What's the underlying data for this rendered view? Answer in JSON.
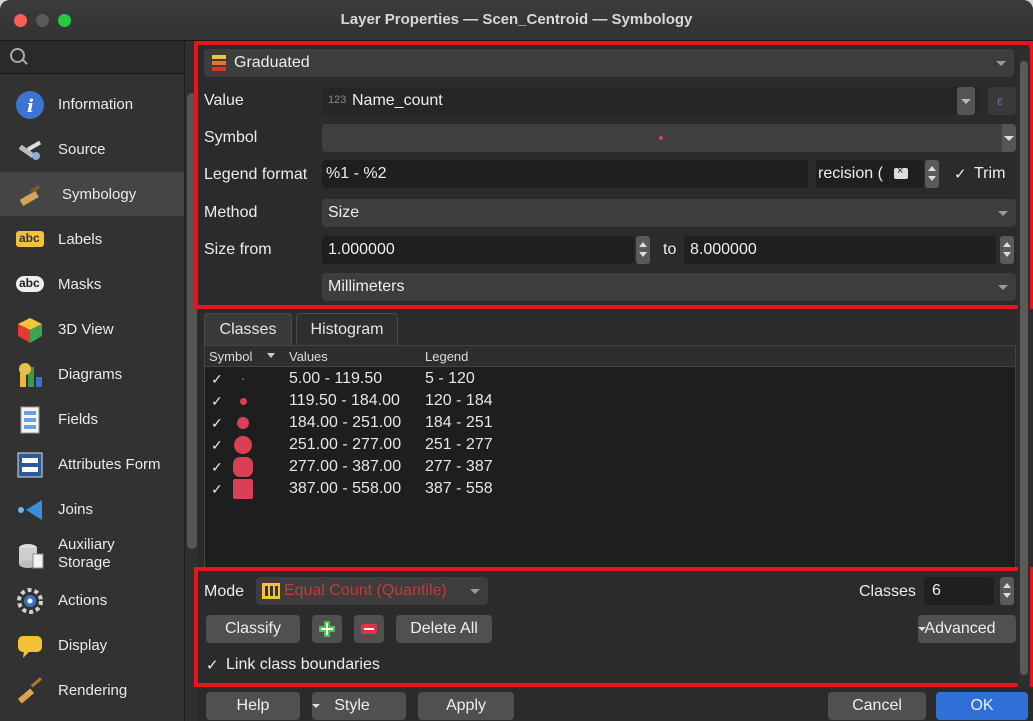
{
  "window": {
    "title": "Layer Properties — Scen_Centroid — Symbology"
  },
  "sidebar": {
    "items": [
      {
        "label": "Information",
        "icon": "info-icon"
      },
      {
        "label": "Source",
        "icon": "source-icon"
      },
      {
        "label": "Symbology",
        "icon": "brush-icon"
      },
      {
        "label": "Labels",
        "icon": "labels-icon"
      },
      {
        "label": "Masks",
        "icon": "masks-icon"
      },
      {
        "label": "3D View",
        "icon": "cube-icon"
      },
      {
        "label": "Diagrams",
        "icon": "diagrams-icon"
      },
      {
        "label": "Fields",
        "icon": "fields-icon"
      },
      {
        "label": "Attributes Form",
        "icon": "form-icon"
      },
      {
        "label": "Joins",
        "icon": "joins-icon"
      },
      {
        "label": "Auxiliary Storage",
        "icon": "storage-icon"
      },
      {
        "label": "Actions",
        "icon": "gear-icon"
      },
      {
        "label": "Display",
        "icon": "display-icon"
      },
      {
        "label": "Rendering",
        "icon": "rendering-icon"
      }
    ],
    "icon_labels": {
      "labels": "abc",
      "masks": "abc"
    },
    "active": "Symbology"
  },
  "renderer": {
    "type": "Graduated"
  },
  "form": {
    "value_label": "Value",
    "value_prefix": "123",
    "value": "Name_count",
    "symbol_label": "Symbol",
    "legend_label": "Legend format",
    "legend_value": "%1 - %2",
    "precision_text": "recision (",
    "trim_label": "Trim",
    "trim_checked": "✓",
    "method_label": "Method",
    "method_value": "Size",
    "size_label": "Size from",
    "size_from": "1.000000",
    "to_label": "to",
    "size_to": "8.000000",
    "unit_value": "Millimeters"
  },
  "tabs": [
    {
      "label": "Classes"
    },
    {
      "label": "Histogram"
    }
  ],
  "table": {
    "headers": {
      "symbol": "Symbol",
      "values": "Values",
      "legend": "Legend"
    },
    "check": "✓",
    "rows": [
      {
        "values": "5.00 - 119.50",
        "legend": "5 - 120"
      },
      {
        "values": "119.50 - 184.00",
        "legend": "120 - 184"
      },
      {
        "values": "184.00 - 251.00",
        "legend": "184 - 251"
      },
      {
        "values": "251.00 - 277.00",
        "legend": "251 - 277"
      },
      {
        "values": "277.00 - 387.00",
        "legend": "277 - 387"
      },
      {
        "values": "387.00 - 558.00",
        "legend": "387 - 558"
      }
    ]
  },
  "bottom": {
    "mode_label": "Mode",
    "mode_value": "Equal Count (Quantile)",
    "classes_label": "Classes",
    "classes_value": "6",
    "classify": "Classify",
    "delete_all": "Delete All",
    "advanced": "Advanced",
    "link_label": "Link class boundaries",
    "link_checked": "✓"
  },
  "footer": {
    "help": "Help",
    "style": "Style",
    "apply": "Apply",
    "cancel": "Cancel",
    "ok": "OK"
  },
  "colors": {
    "highlight": "#e6141b",
    "symbol": "#d93f55",
    "accent": "#2f6fd6"
  }
}
